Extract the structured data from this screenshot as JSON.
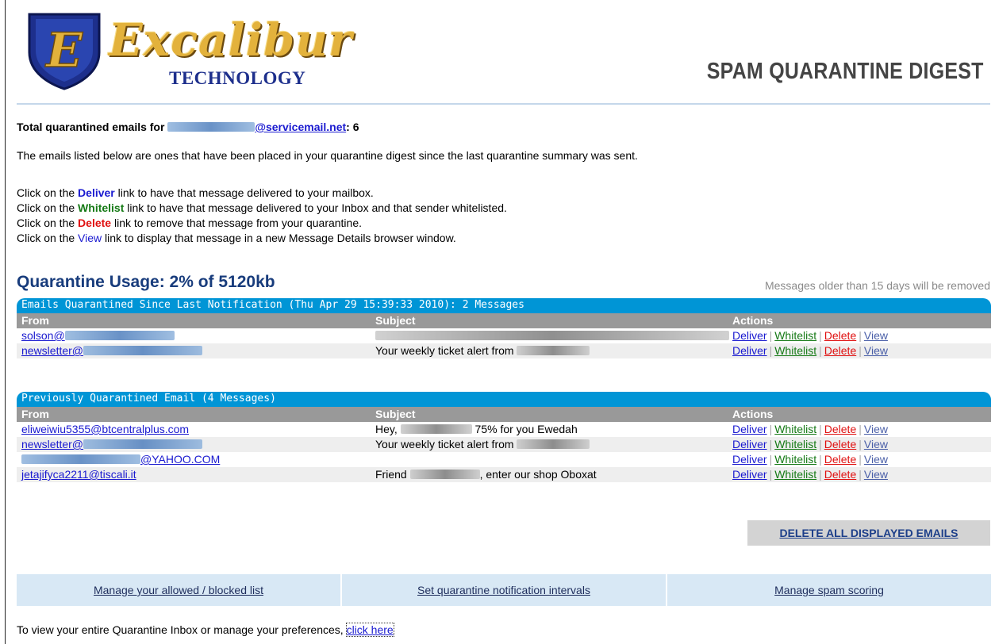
{
  "header": {
    "brand_name": "Excalibur",
    "brand_sub": "TECHNOLOGY",
    "logo_letter": "E",
    "page_title": "SPAM QUARANTINE DIGEST"
  },
  "summary": {
    "total_label": "Total quarantined emails for",
    "email_domain": "@servicemail.net",
    "total_count": ": 6",
    "intro": "The emails listed below are ones that have been placed in your quarantine digest since the last quarantine summary was sent."
  },
  "instructions": {
    "prefix": "Click on the",
    "deliver_word": "Deliver",
    "deliver_rest": "link to have that message delivered to your mailbox.",
    "whitelist_word": "Whitelist",
    "whitelist_rest": "link to have that message delivered to your Inbox and that sender whitelisted.",
    "delete_word": "Delete",
    "delete_rest": "link to remove that message from your quarantine.",
    "view_word": "View",
    "view_rest": "link to display that message in a new Message Details browser window."
  },
  "usage": {
    "title": "Quarantine Usage: 2% of 5120kb",
    "older_note": "Messages older than 15 days will be removed"
  },
  "columns": {
    "from": "From",
    "subject": "Subject",
    "actions": "Actions"
  },
  "actions": {
    "deliver": "Deliver",
    "whitelist": "Whitelist",
    "delete": "Delete",
    "view": "View"
  },
  "recent": {
    "title": "Emails Quarantined Since Last Notification (Thu Apr 29 15:39:33 2010): 2 Messages",
    "rows": [
      {
        "from": "solson@",
        "subject": ""
      },
      {
        "from": "newsletter@",
        "subject": "Your weekly ticket alert from"
      }
    ]
  },
  "previous": {
    "title": "Previously Quarantined Email (4 Messages)",
    "rows": [
      {
        "from": "eliweiwiu5355@btcentralplus.com",
        "subject": "Hey,",
        "subject_after": "75% for you Ewedah"
      },
      {
        "from": "newsletter@",
        "subject": "Your weekly ticket alert from",
        "subject_after": ""
      },
      {
        "from": "@YAHOO.COM",
        "subject": "",
        "subject_after": ""
      },
      {
        "from": "jetajifyca2211@tiscali.it",
        "subject": "Friend",
        "subject_after": ", enter our shop Oboxat"
      }
    ]
  },
  "delete_all": "DELETE ALL DISPLAYED EMAILS",
  "bottom_links": {
    "allowed": "Manage your allowed / blocked list",
    "intervals": "Set quarantine notification intervals",
    "scoring": "Manage spam scoring"
  },
  "footer": {
    "text": "To view your entire Quarantine Inbox or manage your preferences,",
    "link": "click here"
  },
  "colors": {
    "header_blue": "#0095d6",
    "deliver": "#1a1ad0",
    "whitelist": "#167a16",
    "delete": "#e01010"
  }
}
